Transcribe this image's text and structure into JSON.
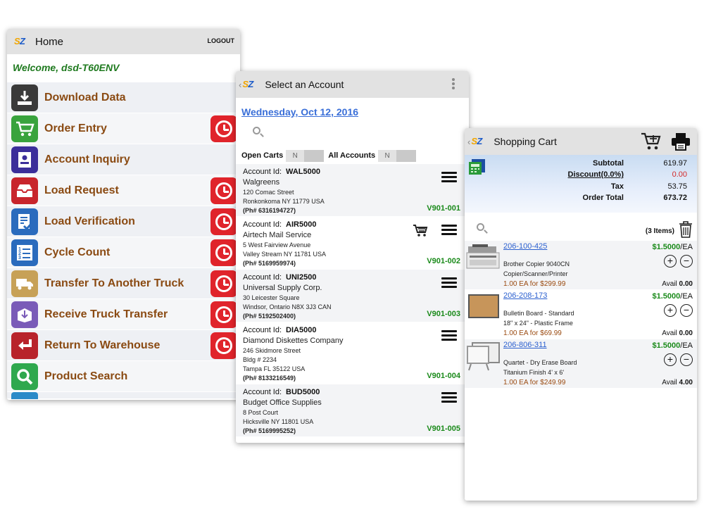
{
  "home": {
    "title": "Home",
    "logout_label": "LOGOUT",
    "welcome": "Welcome, dsd-T60ENV",
    "menu": [
      {
        "label": "Download Data",
        "icon": "download-icon",
        "color": "#3a3a3a",
        "history": false
      },
      {
        "label": "Order Entry",
        "icon": "cart-icon",
        "color": "#39a33d",
        "history": true
      },
      {
        "label": "Account Inquiry",
        "icon": "account-card-icon",
        "color": "#3b2e9a",
        "history": false
      },
      {
        "label": "Load Request",
        "icon": "inbox-tray-icon",
        "color": "#c8252c",
        "history": true
      },
      {
        "label": "Load Verification",
        "icon": "checklist-icon",
        "color": "#2a6bbd",
        "history": true
      },
      {
        "label": "Cycle Count",
        "icon": "numbered-list-icon",
        "color": "#2a6bbd",
        "history": true
      },
      {
        "label": "Transfer To Another Truck",
        "icon": "truck-icon",
        "color": "#c7a157",
        "history": true
      },
      {
        "label": "Receive Truck Transfer",
        "icon": "box-receive-icon",
        "color": "#7a5bb8",
        "history": true
      },
      {
        "label": "Return To Warehouse",
        "icon": "return-arrow-icon",
        "color": "#b8232b",
        "history": true
      },
      {
        "label": "Product Search",
        "icon": "magnifier-icon",
        "color": "#2fa84e",
        "history": false
      }
    ]
  },
  "accounts": {
    "title": "Select an Account",
    "date": "Wednesday, Oct 12, 2016",
    "open_carts_label": "Open Carts",
    "all_accounts_label": "All Accounts",
    "toggle_off": "N",
    "id_label": "Account Id:",
    "list": [
      {
        "id": "WAL5000",
        "name": "Walgreens",
        "street": "120 Comac Street",
        "street2": "",
        "city": "Ronkonkoma  NY  11779  USA",
        "phone": "(Ph# 6316194727)",
        "code": "V901-001",
        "cart": false
      },
      {
        "id": "AIR5000",
        "name": "Airtech Mail Service",
        "street": "5 West Fairview Avenue",
        "street2": "",
        "city": "Valley Stream  NY  11781  USA",
        "phone": "(Ph# 5169959974)",
        "code": "V901-002",
        "cart": true
      },
      {
        "id": "UNI2500",
        "name": "Universal Supply Corp.",
        "street": "30 Leicester Square",
        "street2": "",
        "city": "Windsor, Ontario   N8X 3J3  CAN",
        "phone": "(Ph# 5192502400)",
        "code": "V901-003",
        "cart": false
      },
      {
        "id": "DIA5000",
        "name": "Diamond Diskettes Company",
        "street": "246 Skidmore Street",
        "street2": "Bldg # 2234",
        "city": "Tampa  FL  35122  USA",
        "phone": "(Ph# 8133216549)",
        "code": "V901-004",
        "cart": false
      },
      {
        "id": "BUD5000",
        "name": "Budget Office Supplies",
        "street": "8 Post Court",
        "street2": "",
        "city": "Hicksville  NY  11801  USA",
        "phone": "(Ph# 5169995252)",
        "code": "V901-005",
        "cart": false
      }
    ]
  },
  "cart": {
    "title": "Shopping Cart",
    "totals": {
      "subtotal_label": "Subtotal",
      "subtotal": "619.97",
      "discount_label": "Discount(0.0%)",
      "discount": "0.00",
      "tax_label": "Tax",
      "tax": "53.75",
      "order_total_label": "Order Total",
      "order_total": "673.72"
    },
    "items_count": "(3 Items)",
    "avail_label": "Avail",
    "items": [
      {
        "sku": "206-100-425",
        "price": "$1.5000",
        "unit": "/EA",
        "desc1": "Brother Copier 9040CN",
        "desc2": "Copier/Scanner/Printer",
        "qty": "1.00 EA for $299.99",
        "avail": "0.00",
        "thumb": "copier-thumbnail"
      },
      {
        "sku": "206-208-173",
        "price": "$1.5000",
        "unit": "/EA",
        "desc1": "Bulletin Board - Standard",
        "desc2": "18\" x  24\" - Plastic Frame",
        "qty": "1.00 EA for $69.99",
        "avail": "0.00",
        "thumb": "bulletin-board-thumbnail"
      },
      {
        "sku": "206-806-311",
        "price": "$1.5000",
        "unit": "/EA",
        "desc1": "Quartet - Dry Erase Board",
        "desc2": "Titanium Finish 4' x 6'",
        "qty": "1.00 EA for $249.99",
        "avail": "4.00",
        "thumb": "whiteboard-thumbnail"
      }
    ]
  },
  "colors": {
    "label_brown": "#8a4a12",
    "green_code": "#1a8a1a",
    "link_blue": "#3a6fd8",
    "history_red": "#e0242b",
    "discount_red": "#d42a2a"
  }
}
